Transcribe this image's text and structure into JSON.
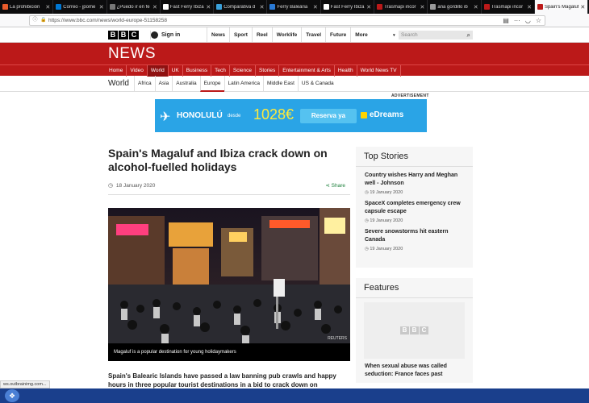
{
  "browser": {
    "tabs": [
      {
        "label": "La prohibición",
        "color": "#e95b2b"
      },
      {
        "label": "Correo - jpome",
        "color": "#0078d4"
      },
      {
        "label": "¿Puedo ir en fe",
        "color": "#777777"
      },
      {
        "label": "Fast Ferry Ibiza",
        "color": "#ffffff"
      },
      {
        "label": "Comparativa d",
        "color": "#3aa0d9"
      },
      {
        "label": "Ferry Baleària",
        "color": "#2a7ad6"
      },
      {
        "label": "Fast Ferry Ibiza",
        "color": "#ffffff"
      },
      {
        "label": "Trasmapi incor",
        "color": "#bb1919"
      },
      {
        "label": "ana gordillo ib",
        "color": "#9a9a9a"
      },
      {
        "label": "Trasmapi incor",
        "color": "#bb1919"
      },
      {
        "label": "Spain's Magaluf",
        "color": "#bb1919",
        "active": true
      }
    ],
    "url": "https://www.bbc.com/news/world-europe-51158258",
    "status_url": "ws.outbrainimg.com..."
  },
  "bbc": {
    "logo": [
      "B",
      "B",
      "C"
    ],
    "signin": "Sign in",
    "topnav": [
      "News",
      "Sport",
      "Reel",
      "Worklife",
      "Travel",
      "Future",
      "More"
    ],
    "search_placeholder": "Search",
    "section_title": "NEWS",
    "rednav": [
      "Home",
      "Video",
      "World",
      "UK",
      "Business",
      "Tech",
      "Science",
      "Stories",
      "Entertainment & Arts",
      "Health",
      "World News TV"
    ],
    "rednav_active": "World",
    "subsection": "World",
    "subnav": [
      "Africa",
      "Asia",
      "Australia",
      "Europe",
      "Latin America",
      "Middle East",
      "US & Canada"
    ],
    "subnav_active": "Europe"
  },
  "ad": {
    "label": "ADVERTISEMENT",
    "destination": "HONOLULÚ",
    "from": "desde",
    "price": "1028€",
    "cta": "Reserva ya",
    "brand": "eDreams"
  },
  "article": {
    "headline": "Spain's Magaluf and Ibiza crack down on alcohol-fuelled holidays",
    "date": "18 January 2020",
    "share": "Share",
    "image_caption": "Magaluf is a popular destination for young holidaymakers",
    "image_credit": "REUTERS",
    "lead": "Spain's Balearic Islands have passed a law banning pub crawls and happy hours in three popular tourist destinations in a bid to crack down on alcohol-"
  },
  "sidebar": {
    "top_stories_title": "Top Stories",
    "stories": [
      {
        "title": "Country wishes Harry and Meghan well - Johnson",
        "date": "19 January 2020"
      },
      {
        "title": "SpaceX completes emergency crew capsule escape",
        "date": "19 January 2020"
      },
      {
        "title": "Severe snowstorms hit eastern Canada",
        "date": "19 January 2020"
      }
    ],
    "features_title": "Features",
    "feature_text": "When sexual abuse was called seduction: France faces past"
  },
  "colors": {
    "bbc_red": "#bb1919",
    "ad_blue": "#2aa4e6",
    "price_yellow": "#ffea3b",
    "share_green": "#1a7f3a"
  }
}
